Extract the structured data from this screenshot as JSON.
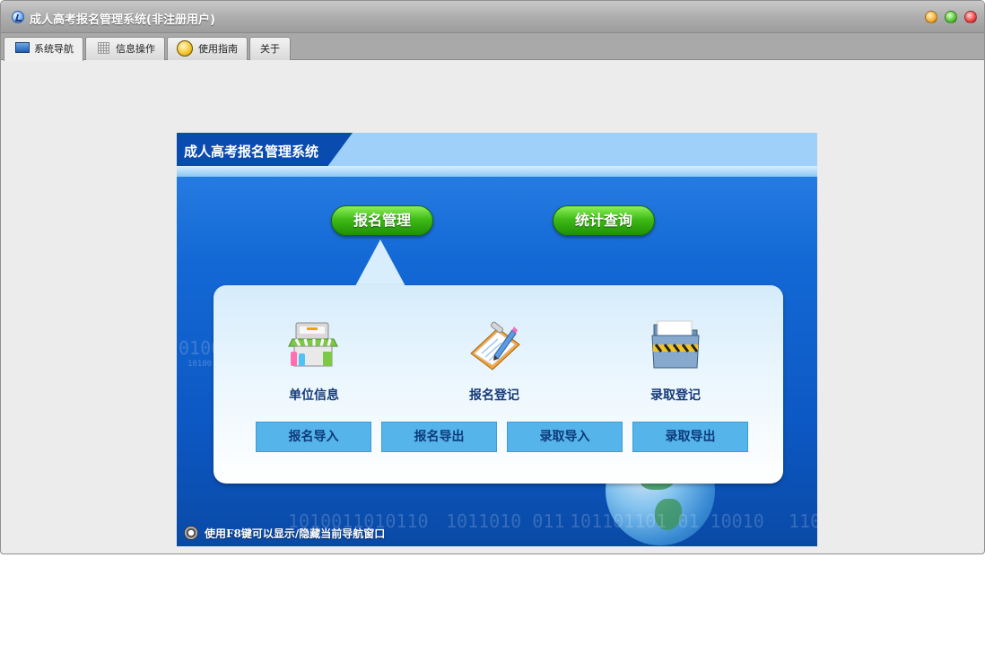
{
  "window": {
    "title": "成人高考报名管理系统(非注册用户)"
  },
  "tabs": [
    {
      "label": "系统导航",
      "icon": "monitor-icon",
      "active": true
    },
    {
      "label": "信息操作",
      "icon": "grid-icon",
      "active": false
    },
    {
      "label": "使用指南",
      "icon": "guide-icon",
      "active": false
    },
    {
      "label": "关于",
      "icon": "",
      "active": false
    }
  ],
  "banner": {
    "title": "成人高考报名管理系统",
    "nav": {
      "registration_management": "报名管理",
      "statistics_query": "统计查询"
    },
    "features": [
      {
        "label": "单位信息",
        "icon": "shop-icon"
      },
      {
        "label": "报名登记",
        "icon": "clipboard-pen-icon"
      },
      {
        "label": "录取登记",
        "icon": "folder-icon"
      }
    ],
    "actions": {
      "reg_import": "报名导入",
      "reg_export": "报名导出",
      "adm_import": "录取导入",
      "adm_export": "录取导出"
    },
    "decor_binary": [
      "0100",
      "10100",
      "1010011010110",
      "1011010  011",
      "101101101 01 10010",
      "110"
    ],
    "footer_hint": "使用F8键可以显示/隐藏当前导航窗口"
  },
  "colors": {
    "accent_green": "#3fbb16",
    "banner_blue": "#1469d6",
    "action_button": "#55b4ea"
  }
}
